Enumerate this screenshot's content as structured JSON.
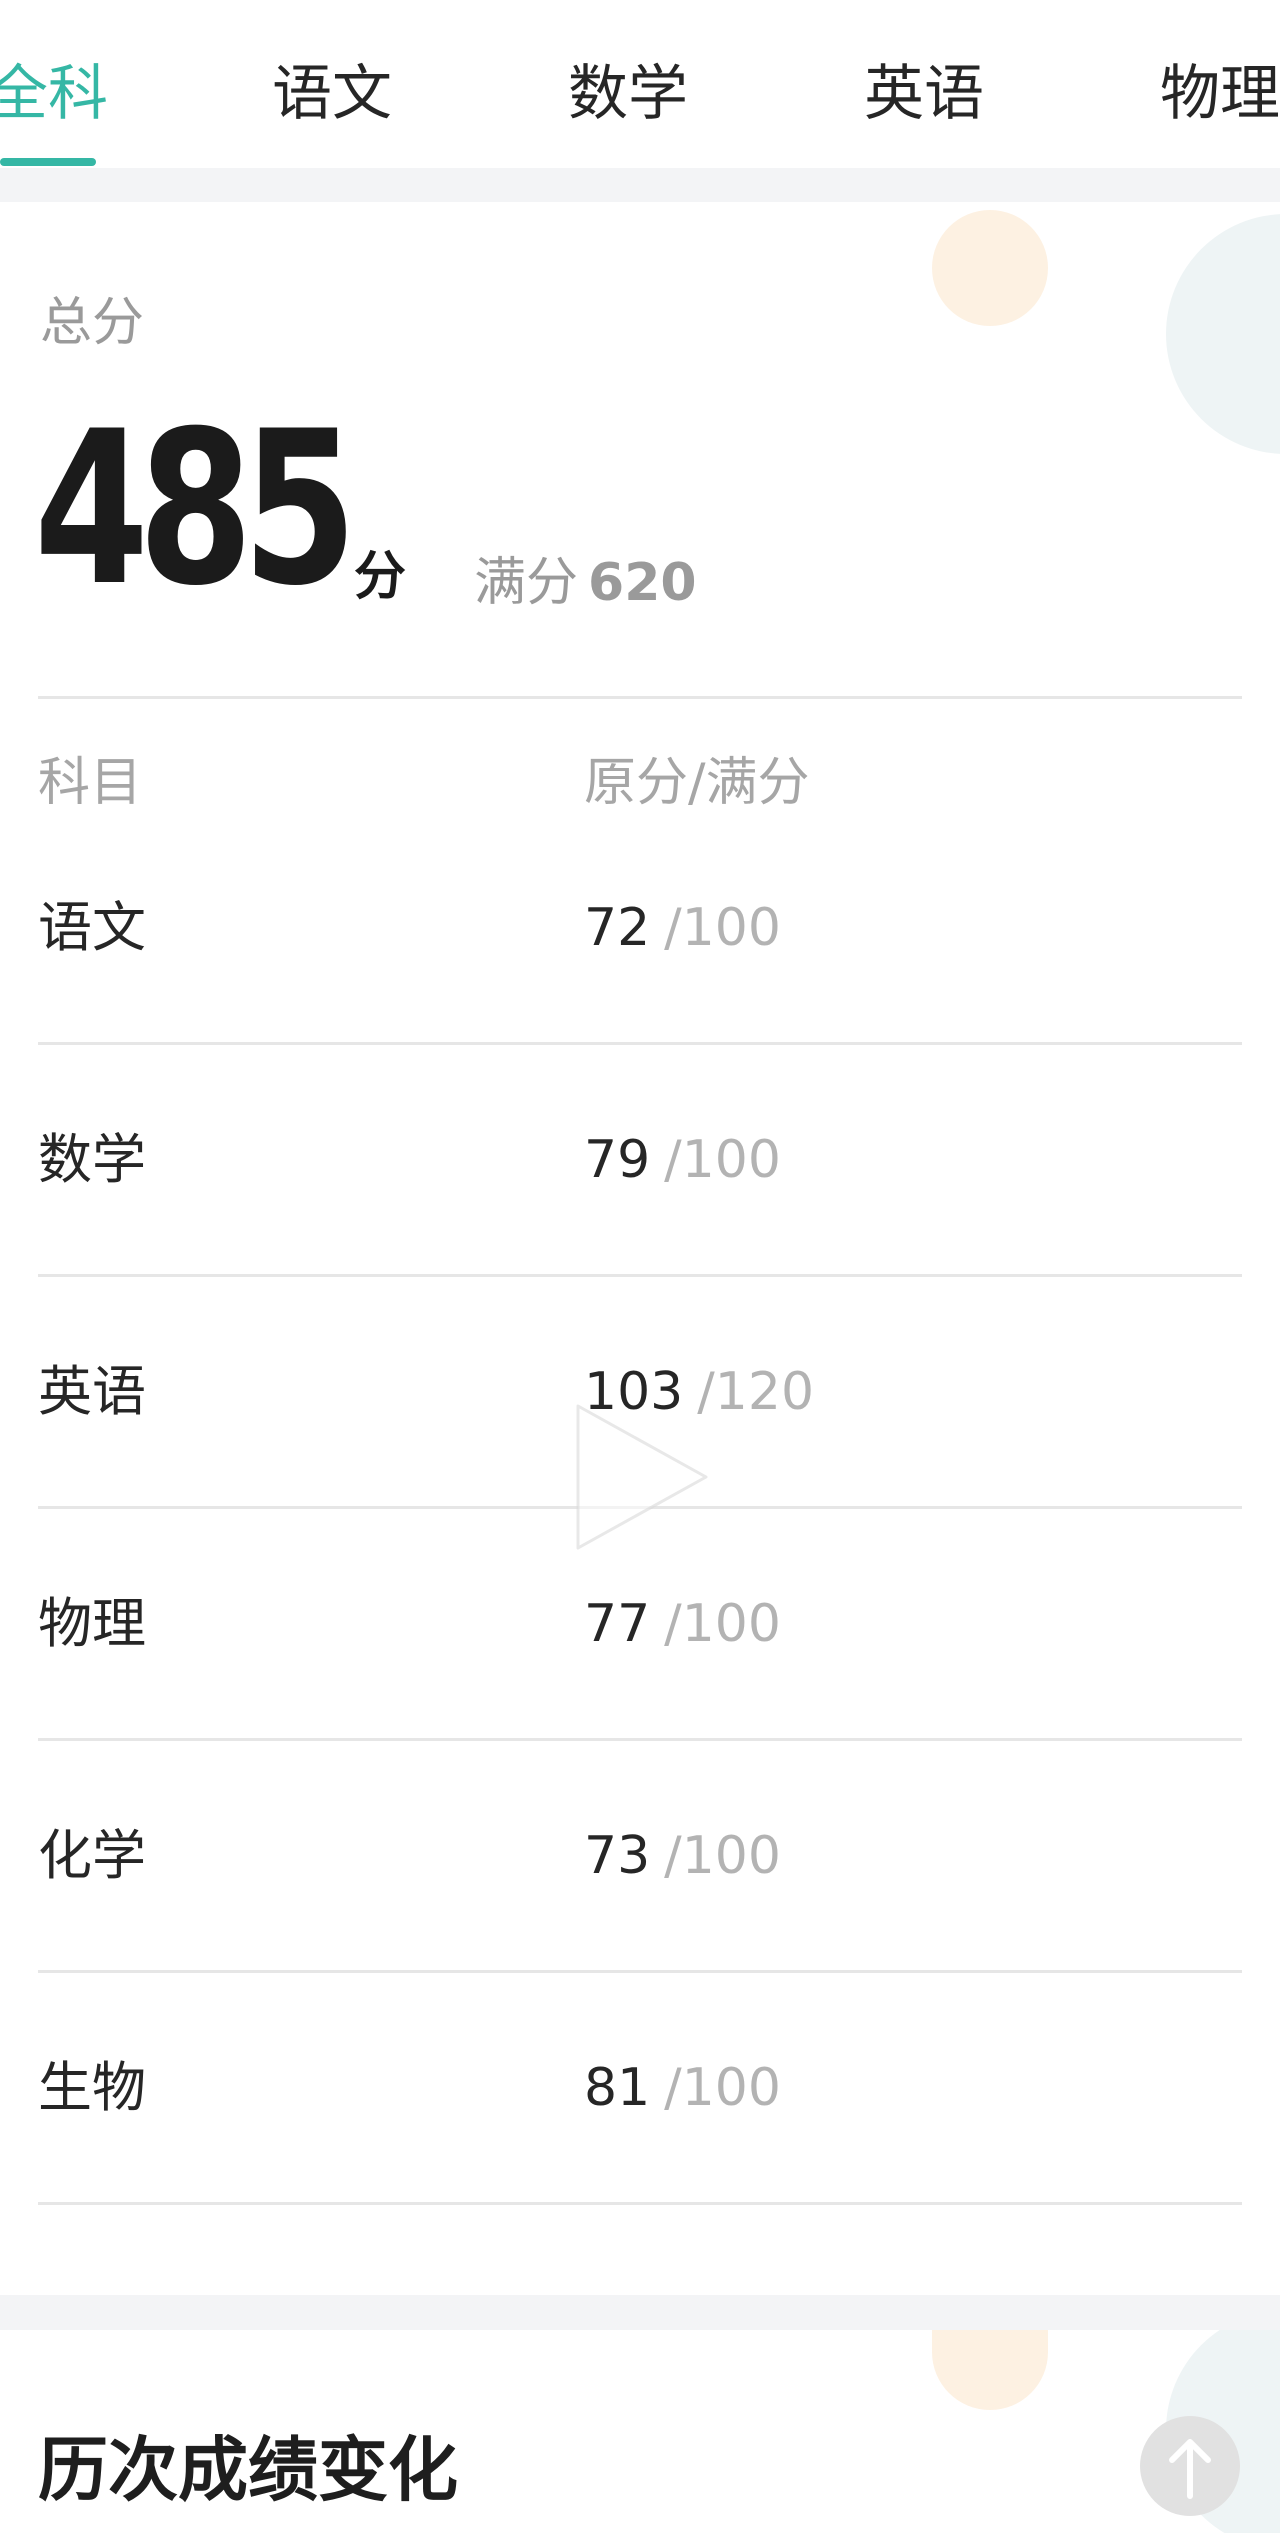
{
  "tabs": [
    {
      "label": "全科",
      "active": true
    },
    {
      "label": "语文",
      "active": false
    },
    {
      "label": "数学",
      "active": false
    },
    {
      "label": "英语",
      "active": false
    },
    {
      "label": "物理",
      "active": false
    }
  ],
  "summary": {
    "total_label": "总分",
    "total_score": "485",
    "total_unit": "分",
    "full_label": "满分",
    "full_value": "620"
  },
  "table": {
    "headers": {
      "subject": "科目",
      "score": "原分/满分"
    },
    "rows": [
      {
        "subject": "语文",
        "raw": "72",
        "full": "/100"
      },
      {
        "subject": "数学",
        "raw": "79",
        "full": "/100"
      },
      {
        "subject": "英语",
        "raw": "103",
        "full": "/120"
      },
      {
        "subject": "物理",
        "raw": "77",
        "full": "/100"
      },
      {
        "subject": "化学",
        "raw": "73",
        "full": "/100"
      },
      {
        "subject": "生物",
        "raw": "81",
        "full": "/100"
      }
    ]
  },
  "history": {
    "title": "历次成绩变化"
  },
  "colors": {
    "accent": "#35b7a5",
    "text": "#262626",
    "muted": "#9a9a9a",
    "background": "#f3f4f6"
  },
  "icons": [
    "play-icon",
    "arrow-up-icon"
  ]
}
